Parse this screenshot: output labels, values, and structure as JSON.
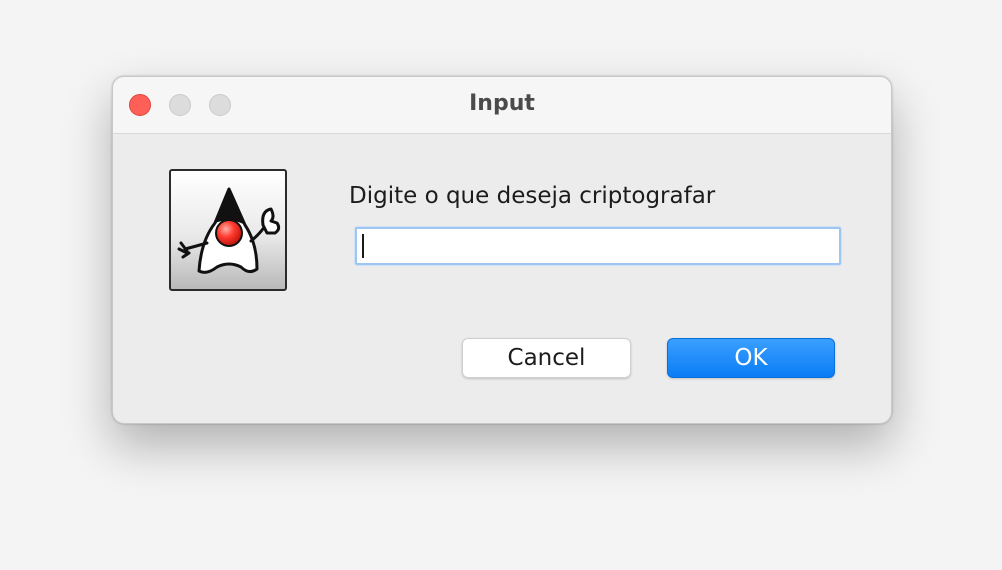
{
  "window": {
    "title": "Input"
  },
  "dialog": {
    "icon": "java-duke-icon",
    "prompt": "Digite o que deseja criptografar",
    "input_value": ""
  },
  "buttons": {
    "cancel_label": "Cancel",
    "ok_label": "OK"
  },
  "colors": {
    "close_button": "#fe5f57",
    "accent": "#0a7cf5"
  }
}
